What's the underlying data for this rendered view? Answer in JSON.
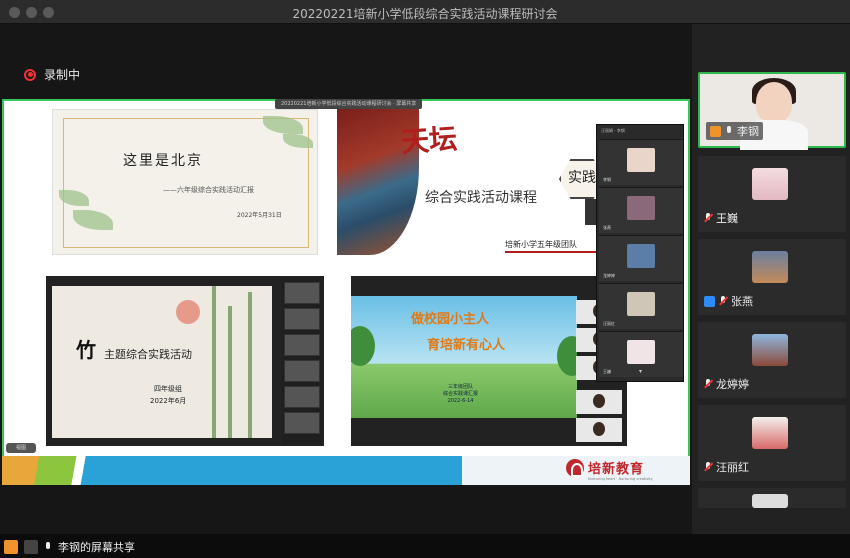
{
  "window": {
    "title": "20220221培新小学低段综合实践活动课程研讨会"
  },
  "recording": {
    "label": "录制中"
  },
  "share_label": "20220221培新小学低段综合实践活动课程研讨会 · 屏幕共享",
  "slides": {
    "s1": {
      "title": "这里是北京",
      "subtitle": "——六年级综合实践活动汇报",
      "date": "2022年5月31日"
    },
    "s2": {
      "heading": "天坛",
      "title": "综合实践活动课程",
      "hex_label": "实践",
      "school": "培新小学五年级团队"
    },
    "s3": {
      "big_char": "竹",
      "title": "主题综合实践活动",
      "grade": "四年级组",
      "date": "2022年6月"
    },
    "s4": {
      "title_line1": "做校园小主人",
      "title_line2": "育培新有心人",
      "sub_line1": "三年级团队",
      "sub_line2": "综合实践课汇报",
      "sub_line3": "2022-6-14"
    }
  },
  "banner": {
    "logo_text": "培新教育",
    "logo_en": "Nurturing heart · Nurturing creativity"
  },
  "overlay": {
    "header": "汪丽娟 · 李钢",
    "tiles": [
      {
        "name": "李钢"
      },
      {
        "name": "张燕"
      },
      {
        "name": "龙婷婷"
      },
      {
        "name": "汪丽红"
      },
      {
        "name": "王巍"
      }
    ],
    "more": "▾"
  },
  "small_button": "视图",
  "gallery": [
    {
      "name": "李钢",
      "active": true,
      "muted": false,
      "role": "host"
    },
    {
      "name": "王巍",
      "active": false,
      "muted": true
    },
    {
      "name": "张燕",
      "active": false,
      "muted": true,
      "role": "cohost"
    },
    {
      "name": "龙婷婷",
      "active": false,
      "muted": true
    },
    {
      "name": "汪丽红",
      "active": false,
      "muted": true
    }
  ],
  "bottombar": {
    "share_label": "李钢的屏幕共享"
  },
  "colors": {
    "active_border": "#2fb84e",
    "record_red": "#e33333",
    "banner_blue": "#2aa2d8",
    "brand_red": "#c0272d"
  }
}
